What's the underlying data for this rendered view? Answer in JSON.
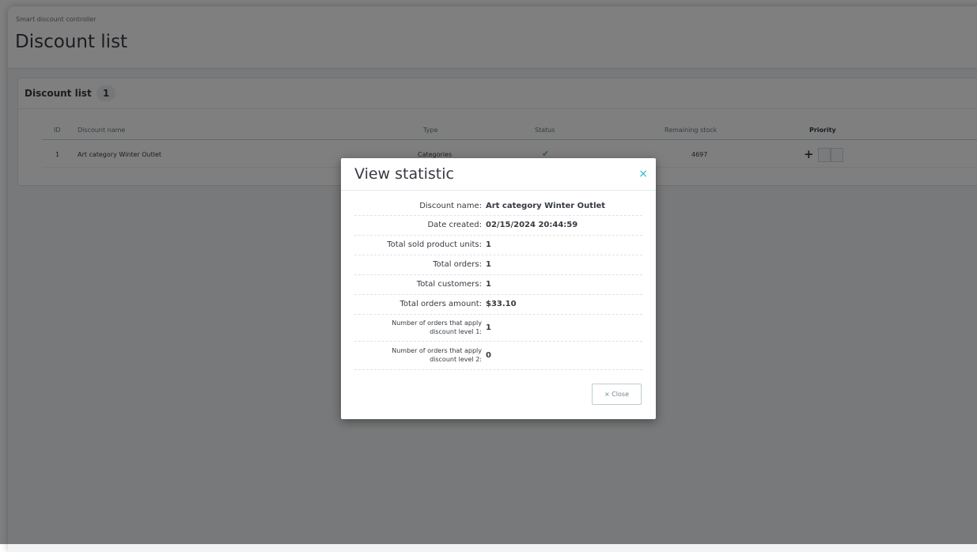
{
  "page": {
    "breadcrumb": "Smart discount controller",
    "title": "Discount list"
  },
  "panel": {
    "title": "Discount list",
    "count": "1"
  },
  "table": {
    "headers": {
      "id": "ID",
      "name": "Discount name",
      "type": "Type",
      "status": "Status",
      "stock": "Remaining stock",
      "priority": "Priority"
    },
    "rows": [
      {
        "id": "1",
        "name": "Art category Winter Outlet",
        "type": "Categories",
        "status_icon": "✔",
        "stock": "4697",
        "priority_icon": "+"
      }
    ]
  },
  "modal": {
    "title": "View statistic",
    "close_icon": "×",
    "close_button": "× Close",
    "stats": [
      {
        "label": "Discount name:",
        "value": "Art category Winter Outlet"
      },
      {
        "label": "Date created:",
        "value": "02/15/2024 20:44:59"
      },
      {
        "label": "Total sold product units:",
        "value": "1"
      },
      {
        "label": "Total orders:",
        "value": "1"
      },
      {
        "label": "Total customers:",
        "value": "1"
      },
      {
        "label": "Total orders amount:",
        "value": "$33.10"
      },
      {
        "label": "Number of orders that apply discount level 1:",
        "value": "1"
      },
      {
        "label": "Number of orders that apply discount level 2:",
        "value": "0"
      }
    ]
  },
  "colors": {
    "accent": "#25b9d7",
    "status_ok": "#70b580"
  }
}
